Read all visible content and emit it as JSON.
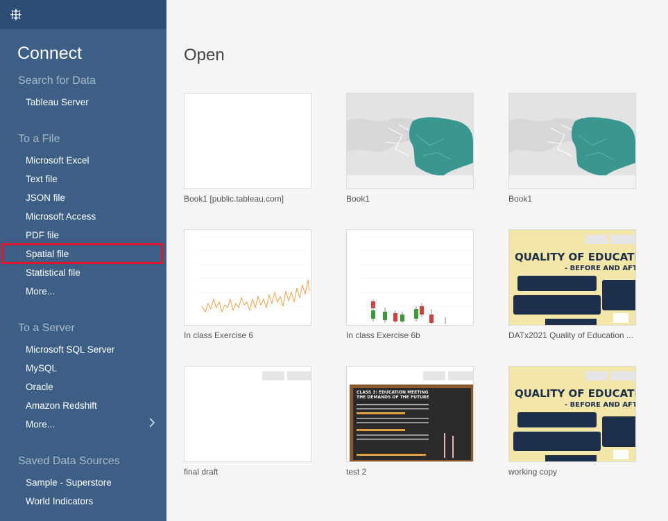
{
  "sidebar": {
    "logo_icon": "tableau-logo-icon",
    "title": "Connect",
    "search_heading": "Search for Data",
    "search_items": [
      "Tableau Server"
    ],
    "file_heading": "To a File",
    "file_items": [
      "Microsoft Excel",
      "Text file",
      "JSON file",
      "Microsoft Access",
      "PDF file",
      "Spatial file",
      "Statistical file",
      "More..."
    ],
    "server_heading": "To a Server",
    "server_items": [
      "Microsoft SQL Server",
      "MySQL",
      "Oracle",
      "Amazon Redshift",
      "More..."
    ],
    "saved_heading": "Saved Data Sources",
    "saved_items": [
      "Sample - Superstore",
      "World Indicators"
    ],
    "highlight_color": "#e2172b",
    "chevron_icon": "chevron-right-icon"
  },
  "main": {
    "title": "Open",
    "workbooks": [
      {
        "name": "Book1 [public.tableau.com]",
        "thumb": "blank"
      },
      {
        "name": "Book1",
        "thumb": "map"
      },
      {
        "name": "Book1",
        "thumb": "map"
      },
      {
        "name": "In class Exercise 6",
        "thumb": "line-chart"
      },
      {
        "name": "In class Exercise 6b",
        "thumb": "candlestick-chart"
      },
      {
        "name": "DATx2021 Quality of Education ...",
        "thumb": "quality-poster",
        "poster_title": "QUALITY OF EDUCATIO",
        "poster_sub": "- BEFORE AND AFT"
      },
      {
        "name": "final draft",
        "thumb": "blank-tabs"
      },
      {
        "name": "test 2",
        "thumb": "chalkboard",
        "board_title": "CLASS 3: EDUCATION MEETING THE DEMANDS OF THE FUTURE"
      },
      {
        "name": "working copy",
        "thumb": "quality-poster",
        "poster_title": "QUALITY OF EDUCATIO",
        "poster_sub": "- BEFORE AND AFT"
      }
    ]
  }
}
